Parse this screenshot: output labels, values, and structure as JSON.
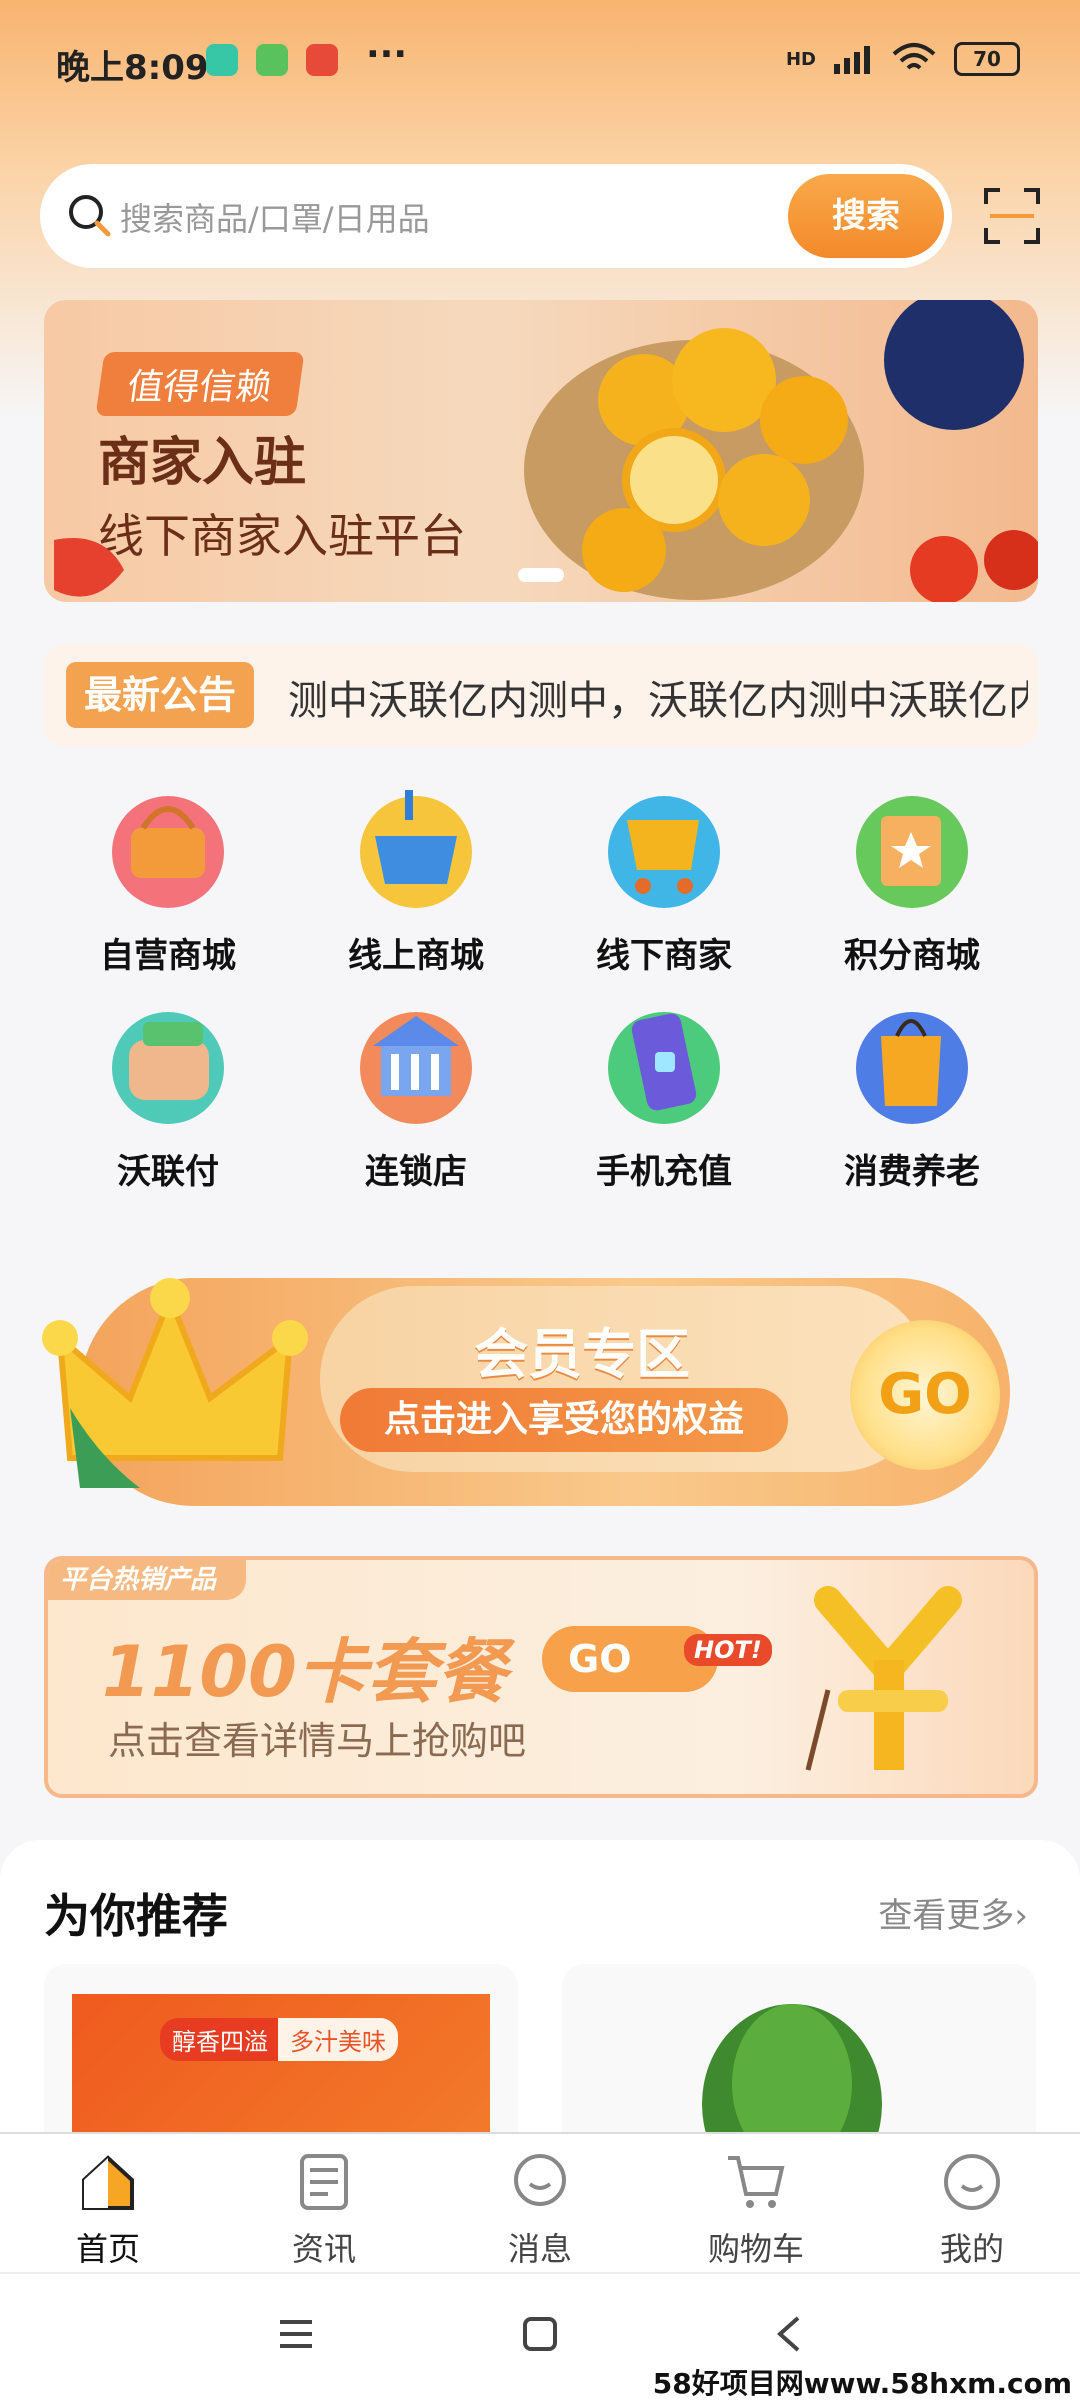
{
  "status_bar": {
    "time": "晚上8:09",
    "dots": "···",
    "battery": "70",
    "network": "HD"
  },
  "search": {
    "placeholder": "搜索商品/口罩/日用品",
    "button_label": "搜索"
  },
  "banner": {
    "tag": "值得信赖",
    "title": "商家入驻",
    "subtitle": "线下商家入驻平台"
  },
  "notice": {
    "label": "最新公告",
    "text": "测中沃联亿内测中，沃联亿内测中沃联亿内"
  },
  "grid": [
    {
      "label": "自营商城",
      "icon": "basket-icon",
      "color": "#f4737a"
    },
    {
      "label": "线上商城",
      "icon": "shopping-basket-icon",
      "color": "#f6c53c"
    },
    {
      "label": "线下商家",
      "icon": "cart-icon",
      "color": "#3fb6e6"
    },
    {
      "label": "积分商城",
      "icon": "gift-bag-icon",
      "color": "#67c85b"
    },
    {
      "label": "沃联付",
      "icon": "wallet-icon",
      "color": "#4fc9b8"
    },
    {
      "label": "连锁店",
      "icon": "store-building-icon",
      "color": "#f28a5c"
    },
    {
      "label": "手机充值",
      "icon": "phone-icon",
      "color": "#4ccb7c"
    },
    {
      "label": "消费养老",
      "icon": "shopping-bag-icon",
      "color": "#4f7de6"
    }
  ],
  "member": {
    "title": "会员专区",
    "button": "点击进入享受您的权益",
    "go": "GO"
  },
  "package": {
    "hot_tag": "平台热销产品",
    "title": "1100卡套餐",
    "go": "GO",
    "badge": "HOT!",
    "subtitle": "点击查看详情马上抢购吧"
  },
  "recommend": {
    "title": "为你推荐",
    "more": "查看更多›",
    "card1_badge1": "醇香四溢",
    "card1_badge2": "多汁美味"
  },
  "tabs": [
    {
      "label": "首页",
      "icon": "home-icon",
      "active": true
    },
    {
      "label": "资讯",
      "icon": "news-icon",
      "active": false
    },
    {
      "label": "消息",
      "icon": "message-icon",
      "active": false
    },
    {
      "label": "购物车",
      "icon": "cart-icon",
      "active": false
    },
    {
      "label": "我的",
      "icon": "profile-icon",
      "active": false
    }
  ],
  "watermark": "58好项目网www.58hxm.com",
  "colors": {
    "accent": "#f39a3c",
    "header_bg": "#f8b470"
  }
}
